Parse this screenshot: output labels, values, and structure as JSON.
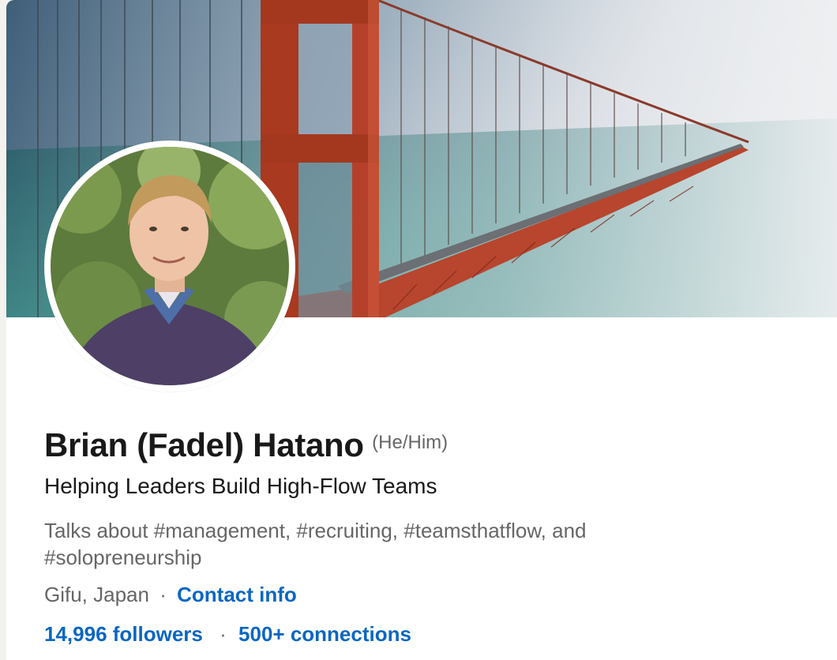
{
  "profile": {
    "name": "Brian (Fadel) Hatano",
    "pronouns": "(He/Him)",
    "headline": "Helping Leaders Build High-Flow Teams",
    "talks_about": "Talks about #management, #recruiting, #teamsthatflow, and #solopreneurship",
    "location": "Gifu, Japan",
    "separator": "·",
    "contact_info_label": "Contact info",
    "followers_label": "14,996 followers",
    "connections_label": "500+ connections"
  },
  "images": {
    "banner": "golden-gate-bridge-banner",
    "avatar": "profile-photo"
  },
  "colors": {
    "link": "#0a66c2",
    "name": "#191919",
    "secondary_text": "#666666",
    "bridge": "#c0432a"
  }
}
